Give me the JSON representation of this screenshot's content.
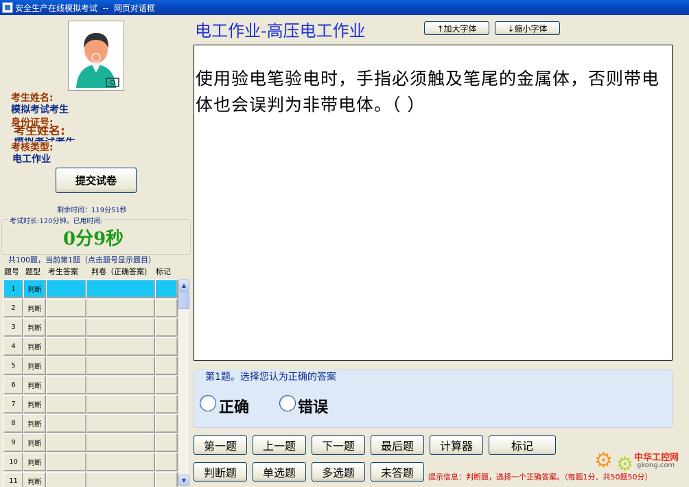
{
  "window": {
    "title": "安全生产在线模拟考试  --  网页对话框"
  },
  "candidate": {
    "name_label": "考生姓名:",
    "name_value": "模拟考试考生",
    "id_label": "身份证号:",
    "exam_type_label": "考核类型:",
    "exam_type_value": "电工作业",
    "ghost_name_label": "考生姓名:",
    "ghost_name_value": "模拟考试考生"
  },
  "submit_button": "提交试卷",
  "timer": {
    "remaining": "剩余时间：119分51秒",
    "duration": "考试时长:120分钟。已用时间:",
    "elapsed": "0分9秒"
  },
  "question_list": {
    "summary": "共100题，当前第1题（点击题号显示题目）",
    "headers": [
      "题号",
      "题型",
      "考生答案",
      "判卷（正确答案）",
      "标记"
    ],
    "rows": [
      {
        "num": "1",
        "type": "判断"
      },
      {
        "num": "2",
        "type": "判断"
      },
      {
        "num": "3",
        "type": "判断"
      },
      {
        "num": "4",
        "type": "判断"
      },
      {
        "num": "5",
        "type": "判断"
      },
      {
        "num": "6",
        "type": "判断"
      },
      {
        "num": "7",
        "type": "判断"
      },
      {
        "num": "8",
        "type": "判断"
      },
      {
        "num": "9",
        "type": "判断"
      },
      {
        "num": "10",
        "type": "判断"
      },
      {
        "num": "11",
        "type": "判断"
      }
    ],
    "selected_index": 0
  },
  "subject_title": "电工作业-高压电工作业",
  "font_buttons": {
    "increase": "↑加大字体",
    "decrease": "↓缩小字体"
  },
  "question": {
    "text": "使用验电笔验电时，手指必须触及笔尾的金属体，否则带电体也会误判为非带电体。（  ）"
  },
  "answer": {
    "legend": "第1题。选择您认为正确的答案",
    "options": [
      "正确",
      "错误"
    ]
  },
  "nav_buttons": [
    "第一题",
    "上一题",
    "下一题",
    "最后题",
    "计算器",
    "标记"
  ],
  "filter_buttons": [
    "判断题",
    "单选题",
    "多选题",
    "未答题"
  ],
  "tip": "提示信息：判断题，选择一个正确答案。（每题1分、共50题50分）",
  "watermark": {
    "name": "中华工控网",
    "url": "gkong.com"
  },
  "colors": {
    "selected_row": "#1ac6f4",
    "title_blue": "#1f2fd6",
    "label_brown": "#993300",
    "timer_green": "#1a9a1a",
    "tip_red": "#d40000"
  }
}
